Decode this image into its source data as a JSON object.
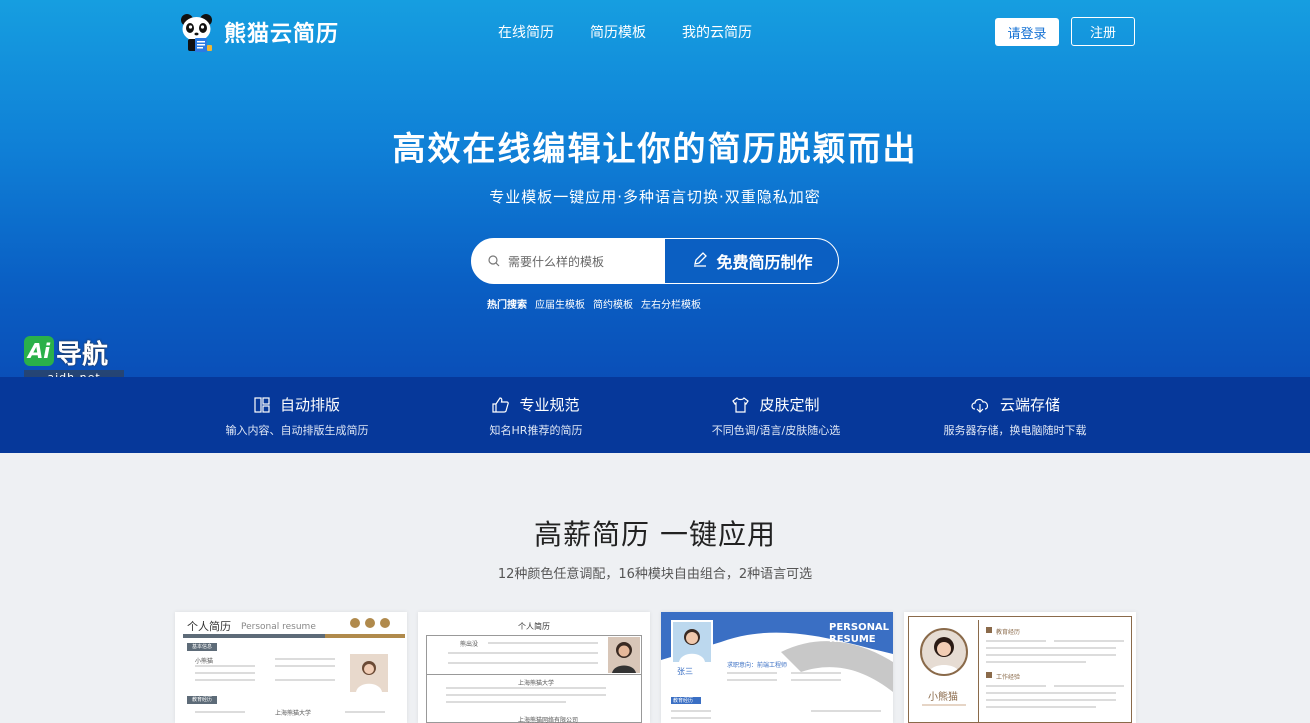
{
  "brand": {
    "name": "熊猫云简历"
  },
  "nav": {
    "items": [
      "在线简历",
      "简历模板",
      "我的云简历"
    ]
  },
  "auth": {
    "login": "请登录",
    "register": "注册"
  },
  "hero": {
    "title": "高效在线编辑让你的简历脱颖而出",
    "subtitle": "专业模板一键应用·多种语言切换·双重隐私加密",
    "search_placeholder": "需要什么样的模板",
    "cta": "免费简历制作",
    "hot_label": "热门搜索",
    "hot_items": [
      "应届生模板",
      "简约模板",
      "左右分栏模板"
    ]
  },
  "watermark": {
    "logo": "Ai",
    "text": "导航",
    "url": "aidh.net"
  },
  "features": [
    {
      "title": "自动排版",
      "desc": "输入内容、自动排版生成简历",
      "icon": "layout-icon"
    },
    {
      "title": "专业规范",
      "desc": "知名HR推荐的简历",
      "icon": "thumbs-up-icon"
    },
    {
      "title": "皮肤定制",
      "desc": "不同色调/语言/皮肤随心选",
      "icon": "shirt-icon"
    },
    {
      "title": "云端存储",
      "desc": "服务器存储，换电脑随时下载",
      "icon": "cloud-download-icon"
    }
  ],
  "section": {
    "title": "高薪简历 一键应用",
    "subtitle": "12种颜色任意调配，16种模块自由组合，2种语言可选"
  },
  "templates": [
    {
      "title": "个人简历",
      "subtitle": "Personal resume",
      "section": "基本信息",
      "section2": "教育经历",
      "name": "小熊猫",
      "school": "上海熊猫大学"
    },
    {
      "title": "个人简历",
      "name": "熊出没",
      "school": "上海熊猫大学",
      "company": "上海熊猫网络有限公司"
    },
    {
      "title": "PERSONAL",
      "title2": "RESUME",
      "name": "张三",
      "intent": "求职意向：前端工程师",
      "section": "教育经历"
    },
    {
      "name": "小熊猫",
      "section": "教育经历",
      "section2": "工作经验"
    }
  ],
  "colors": {
    "hero_top": "#169ee0",
    "hero_bottom": "#0a4fb8",
    "feature_bar": "#06389a",
    "primary": "#0b5fc2"
  }
}
